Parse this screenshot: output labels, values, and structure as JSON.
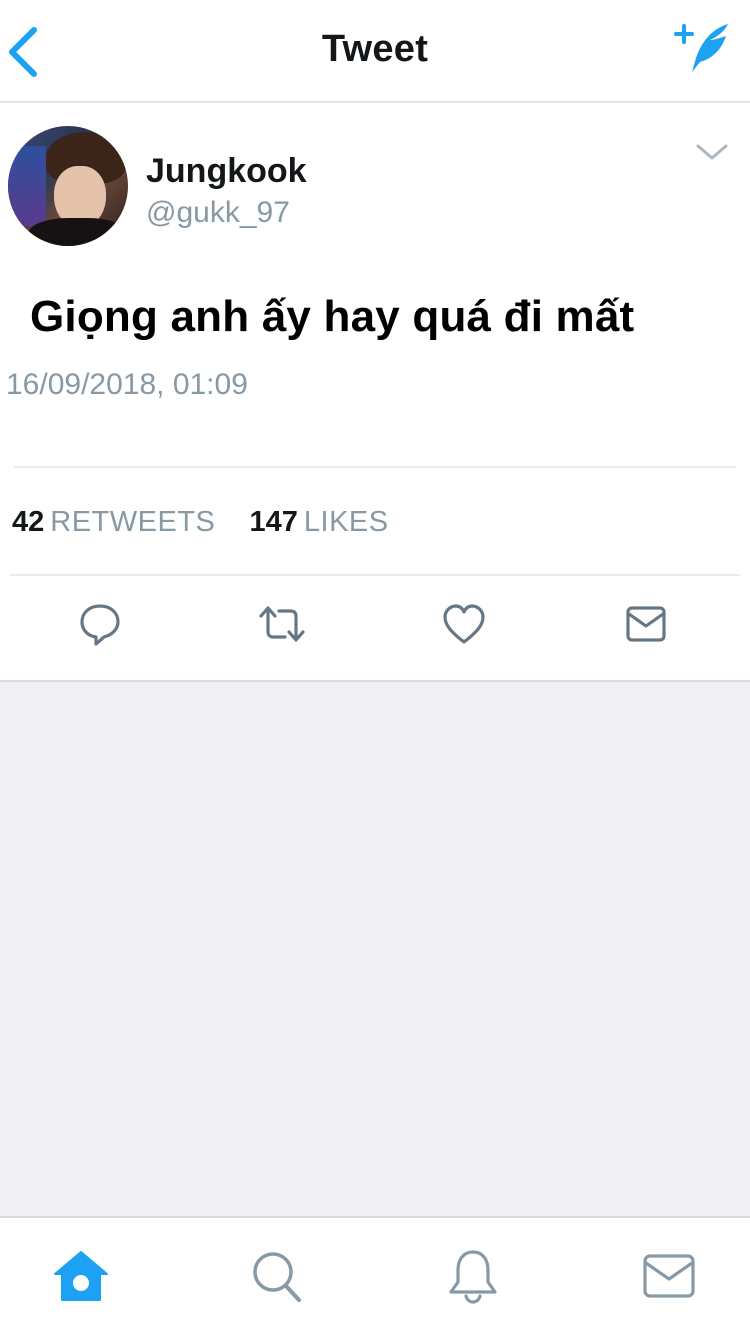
{
  "header": {
    "title": "Tweet",
    "back_icon": "chevron-left-icon",
    "compose_icon": "compose-tweet-icon"
  },
  "tweet": {
    "author": {
      "display_name": "Jungkook",
      "handle": "@gukk_97"
    },
    "text": "Giọng anh ấy hay quá đi mất",
    "timestamp": "16/09/2018, 01:09",
    "stats": {
      "retweets_count": "42",
      "retweets_label": "RETWEETS",
      "likes_count": "147",
      "likes_label": "LIKES"
    },
    "actions": [
      "reply-icon",
      "retweet-icon",
      "like-icon",
      "share-icon"
    ]
  },
  "tabbar": {
    "items": [
      "home-icon",
      "search-icon",
      "notifications-icon",
      "messages-icon"
    ],
    "active": "home-icon"
  },
  "colors": {
    "brand_blue": "#1da1f2",
    "text_primary": "#14171a",
    "text_secondary": "#8899a6",
    "background_gray": "#efeff4",
    "icon_gray": "#657786"
  }
}
